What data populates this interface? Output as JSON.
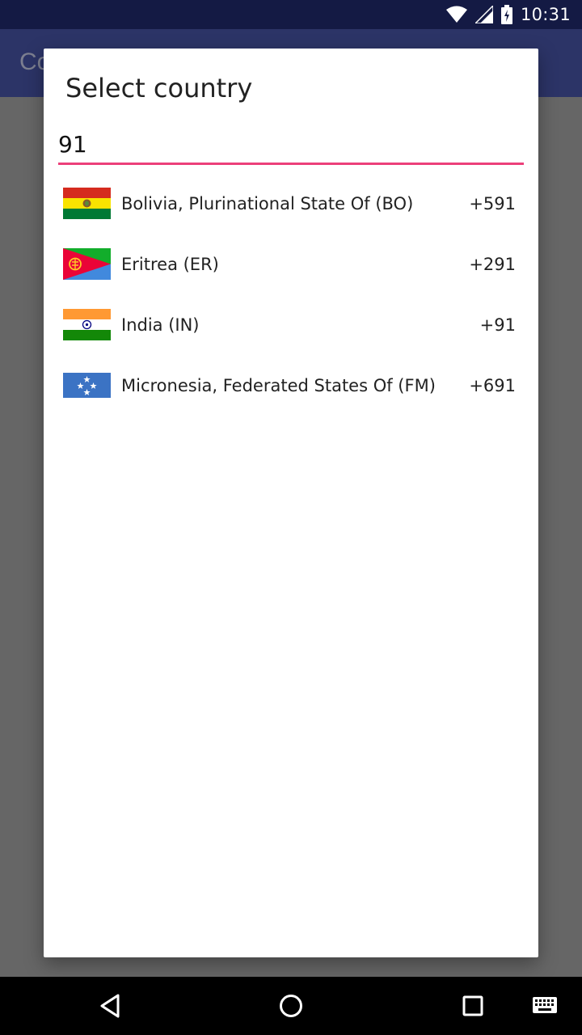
{
  "status_bar": {
    "time": "10:31",
    "icons": [
      "wifi-icon",
      "signal-icon",
      "battery-charging-icon"
    ]
  },
  "app_bar": {
    "title": "Co"
  },
  "dialog": {
    "title": "Select country",
    "search": {
      "value": "91",
      "placeholder": ""
    },
    "countries": [
      {
        "name": "Bolivia, Plurinational State Of (BO)",
        "code": "+591",
        "flag": "bolivia-flag"
      },
      {
        "name": "Eritrea (ER)",
        "code": "+291",
        "flag": "eritrea-flag"
      },
      {
        "name": "India (IN)",
        "code": "+91",
        "flag": "india-flag"
      },
      {
        "name": "Micronesia, Federated States Of (FM)",
        "code": "+691",
        "flag": "micronesia-flag"
      }
    ]
  },
  "nav_bar": {
    "buttons": [
      "back-icon",
      "home-icon",
      "recents-icon",
      "keyboard-icon"
    ]
  },
  "colors": {
    "status_bar": "#141a44",
    "app_bar": "#2c3467",
    "accent": "#ec407a",
    "scrim": "#666666"
  }
}
